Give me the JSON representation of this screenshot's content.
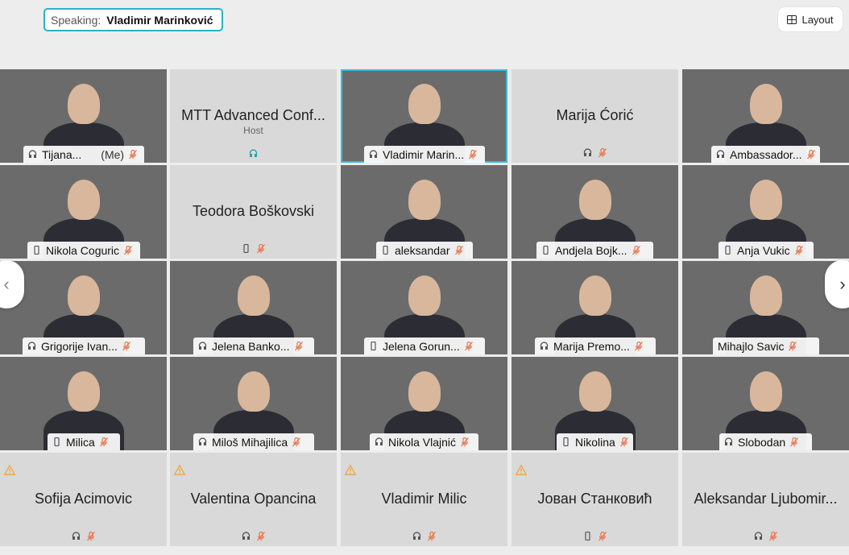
{
  "header": {
    "speaking_label": "Speaking:",
    "speaking_name": "Vladimir Marinković",
    "layout_label": "Layout"
  },
  "tiles": [
    {
      "name": "Tijana...",
      "me": "(Me)",
      "type": "video",
      "bg": "bg-lib",
      "mic": "headset"
    },
    {
      "name": "MTT Advanced Conf...",
      "sub": "Host",
      "type": "text",
      "mic": "host"
    },
    {
      "name": "Vladimir Marin...",
      "type": "video",
      "bg": "bg-lib",
      "mic": "headset",
      "speaker": true
    },
    {
      "name": "Marija Ćorić",
      "type": "text",
      "mic": "headset"
    },
    {
      "name": "Ambassador...",
      "type": "video",
      "bg": "bg-blue",
      "mic": "headset"
    },
    {
      "name": "Nikola Coguric",
      "type": "video",
      "bg": "bg-dark",
      "mic": "phone"
    },
    {
      "name": "Teodora Boškovski",
      "type": "text",
      "mic": "phone"
    },
    {
      "name": "aleksandar",
      "type": "video",
      "bg": "bg-room",
      "mic": "phone"
    },
    {
      "name": "Andjela Bojk...",
      "type": "video",
      "bg": "bg-light",
      "mic": "phone"
    },
    {
      "name": "Anja Vukic",
      "type": "video",
      "bg": "bg-wall",
      "mic": "phone"
    },
    {
      "name": "Grigorije Ivan...",
      "type": "video",
      "bg": "bg-warm",
      "mic": "headset"
    },
    {
      "name": "Jelena Banko...",
      "type": "video",
      "bg": "bg-room",
      "mic": "headset"
    },
    {
      "name": "Jelena Gorun...",
      "type": "video",
      "bg": "bg-warm",
      "mic": "phone"
    },
    {
      "name": "Marija Premo...",
      "type": "video",
      "bg": "bg-light",
      "mic": "headset"
    },
    {
      "name": "Mihajlo Savic",
      "type": "video",
      "bg": "bg-light",
      "mic": "none"
    },
    {
      "name": "Milica",
      "type": "video",
      "bg": "bg-dark",
      "mic": "phone"
    },
    {
      "name": "Miloš Mihajilica",
      "type": "video",
      "bg": "bg-light",
      "mic": "headset"
    },
    {
      "name": "Nikola Vlajnić",
      "type": "video",
      "bg": "bg-green",
      "mic": "headset"
    },
    {
      "name": "Nikolina",
      "type": "video",
      "bg": "bg-dark",
      "mic": "phone"
    },
    {
      "name": "Slobodan",
      "type": "video",
      "bg": "bg-light",
      "mic": "headset"
    },
    {
      "name": "Sofija Acimovic",
      "type": "text",
      "warn": true,
      "mic": "headset"
    },
    {
      "name": "Valentina Opancina",
      "type": "text",
      "warn": true,
      "mic": "headset"
    },
    {
      "name": "Vladimir Milic",
      "type": "text",
      "warn": true,
      "mic": "headset"
    },
    {
      "name": "Јован Станковић",
      "type": "text",
      "warn": true,
      "mic": "phone"
    },
    {
      "name": "Aleksandar Ljubomir...",
      "type": "text",
      "mic": "headset"
    }
  ],
  "colors": {
    "accent": "#2ab3c4",
    "mute": "#e8734a",
    "warn": "#f1a63a"
  },
  "icons": {
    "prev": "chevron-left-icon",
    "next": "chevron-right-icon",
    "layout": "grid-layout-icon"
  }
}
